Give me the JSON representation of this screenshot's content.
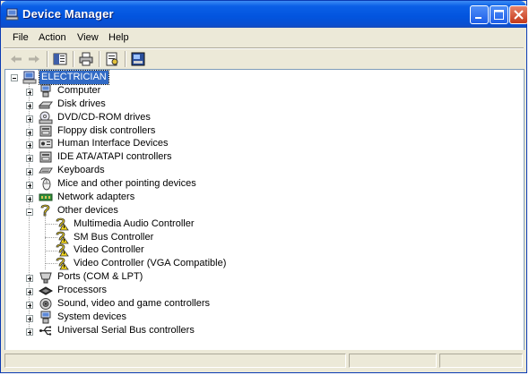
{
  "window": {
    "title": "Device Manager"
  },
  "menu": [
    "File",
    "Action",
    "View",
    "Help"
  ],
  "toolbar": {
    "buttons": [
      "back-arrow-icon",
      "forward-arrow-icon",
      "show-hide-console-tree-icon",
      "print-icon",
      "properties-icon",
      "help-icon"
    ]
  },
  "tree": {
    "root": "ELECTRICIAN",
    "categories": [
      "Computer",
      "Disk drives",
      "DVD/CD-ROM drives",
      "Floppy disk controllers",
      "Human Interface Devices",
      "IDE ATA/ATAPI controllers",
      "Keyboards",
      "Mice and other pointing devices",
      "Network adapters",
      "Other devices",
      "Multimedia Audio Controller",
      "SM Bus Controller",
      "Video Controller",
      "Video Controller (VGA Compatible)",
      "Ports (COM & LPT)",
      "Processors",
      "Sound, video and game controllers",
      "System devices",
      "Universal Serial Bus controllers"
    ]
  },
  "colors": {
    "selection": "#316ac5",
    "title_bar": "#0254de",
    "warning": "#f2d51c"
  }
}
